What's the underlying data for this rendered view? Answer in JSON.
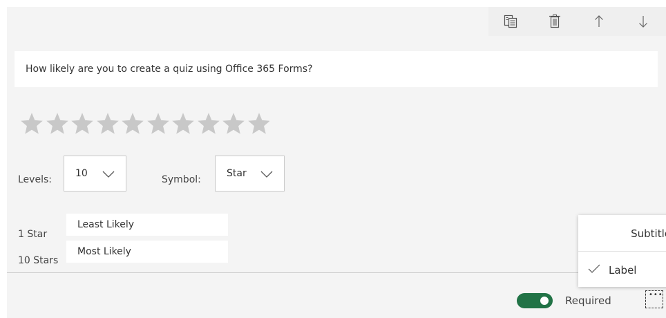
{
  "toolbar": {
    "icons": [
      "copy-icon",
      "delete-icon",
      "move-up-icon",
      "move-down-icon"
    ]
  },
  "question": {
    "title": "How likely are you to create a quiz using Office 365 Forms?"
  },
  "rating": {
    "levels": 10,
    "symbol_icon": "star-icon",
    "star_color": "#c8c8c8"
  },
  "settings": {
    "levels_label": "Levels:",
    "levels_value": "10",
    "symbol_label": "Symbol:",
    "symbol_value": "Star"
  },
  "labels": {
    "low_name": "1 Star",
    "low_value": "Least Likely",
    "high_name": "10 Stars",
    "high_value": "Most Likely"
  },
  "footer": {
    "required_label": "Required",
    "required_on": true,
    "toggle_color": "#217346"
  },
  "menu": {
    "subtitle_label": "Subtitle",
    "label_label": "Label",
    "label_checked": true
  }
}
